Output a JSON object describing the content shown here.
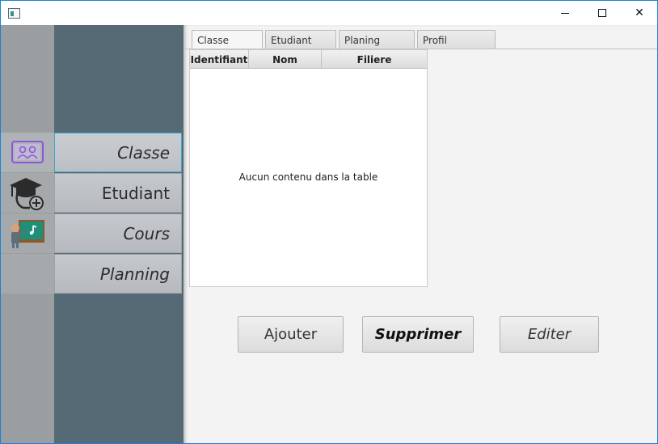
{
  "titlebar": {
    "minimize_icon": "minimize-icon",
    "maximize_icon": "maximize-icon",
    "close_icon": "close-icon",
    "close_glyph": "✕"
  },
  "nav": {
    "items": [
      {
        "label": "Classe",
        "icon": "classroom-icon",
        "active": true
      },
      {
        "label": "Etudiant",
        "icon": "graduate-add-icon",
        "active": false
      },
      {
        "label": "Cours",
        "icon": "teacher-board-icon",
        "active": false
      },
      {
        "label": "Planning",
        "icon": "",
        "active": false
      }
    ]
  },
  "tabs": [
    {
      "label": "Classe",
      "active": true
    },
    {
      "label": "Etudiant",
      "active": false
    },
    {
      "label": "Planing",
      "active": false
    },
    {
      "label": "Profil",
      "active": false
    }
  ],
  "table": {
    "columns": [
      "Identifiant",
      "Nom",
      "Filiere"
    ],
    "rows": [],
    "empty_message": "Aucun contenu dans la table"
  },
  "actions": {
    "add_label": "Ajouter",
    "delete_label": "Supprimer",
    "edit_label": "Editer"
  },
  "colors": {
    "side_panel": "#566a76",
    "icon_strip": "#9a9ea1",
    "active_border": "#3fa6d0",
    "window_border": "#1883d7"
  }
}
